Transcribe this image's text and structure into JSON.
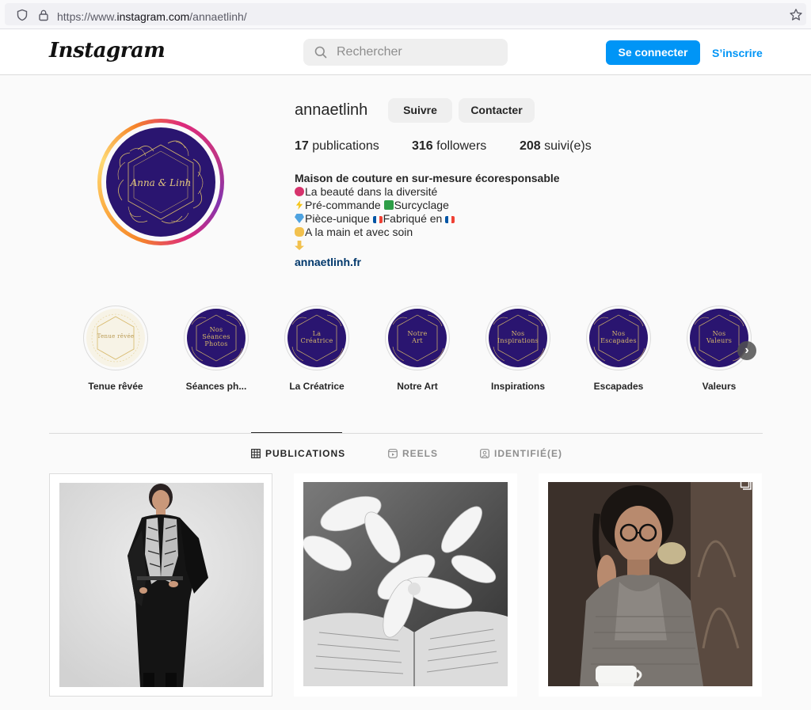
{
  "browser": {
    "url_prefix": "https://www.",
    "url_host": "instagram.com",
    "url_path": "/annaetlinh/",
    "icons": [
      "shield-icon",
      "lock-icon",
      "star-icon"
    ]
  },
  "header": {
    "logo": "Instagram",
    "search_placeholder": "Rechercher",
    "login_label": "Se connecter",
    "signup_label": "S’inscrire",
    "accent_color": "#0095f6"
  },
  "profile": {
    "username": "annaetlinh",
    "follow_label": "Suivre",
    "contact_label": "Contacter",
    "avatar_signature": "Anna & Linh",
    "stats": [
      {
        "count": "17",
        "label": " publications"
      },
      {
        "count": "316",
        "label": " followers"
      },
      {
        "count": "208",
        "label": " suivi(e)s"
      }
    ],
    "bio": {
      "name": "Maison de couture en sur-mesure écoresponsable",
      "lines": [
        {
          "emoji": "rose-icon",
          "text": "La beauté dans la diversité"
        },
        {
          "emoji": "lightning-icon",
          "text": "Pré-commande ",
          "emoji2": "recycle-icon",
          "text2": "Surcyclage"
        },
        {
          "emoji": "gem-icon",
          "text": "Pièce-unique ",
          "emoji2": "flag-fr-icon",
          "text2": "Fabriqué en ",
          "emoji3": "flag-fr-icon"
        },
        {
          "emoji": "hands-icon",
          "text": "A la main et avec soin"
        },
        {
          "emoji": "pointing-down-icon",
          "text": ""
        }
      ],
      "link": "annaetlinh.fr"
    }
  },
  "highlights": [
    {
      "label": "Tenue rêvée",
      "cover": "Tenue rêvée",
      "style": "light"
    },
    {
      "label": "Séances ph...",
      "cover": "Nos Séances Photos",
      "style": "dark"
    },
    {
      "label": "La Créatrice",
      "cover": "La Créatrice",
      "style": "dark"
    },
    {
      "label": "Notre Art",
      "cover": "Notre Art",
      "style": "dark"
    },
    {
      "label": "Inspirations",
      "cover": "Nos Inspirations",
      "style": "dark"
    },
    {
      "label": "Escapades",
      "cover": "Nos Escapades",
      "style": "dark"
    },
    {
      "label": "Valeurs",
      "cover": "Nos Valeurs",
      "style": "dark"
    }
  ],
  "tabs": [
    {
      "label": "PUBLICATIONS",
      "icon": "grid-icon",
      "active": true
    },
    {
      "label": "REELS",
      "icon": "reels-icon",
      "active": false
    },
    {
      "label": "IDENTIFIÉ(E)",
      "icon": "tagged-icon",
      "active": false
    }
  ],
  "posts": [
    {
      "subject": "woman-in-black-kimono-photo"
    },
    {
      "subject": "flowers-on-book-photo"
    },
    {
      "subject": "woman-with-glasses-photo"
    }
  ]
}
